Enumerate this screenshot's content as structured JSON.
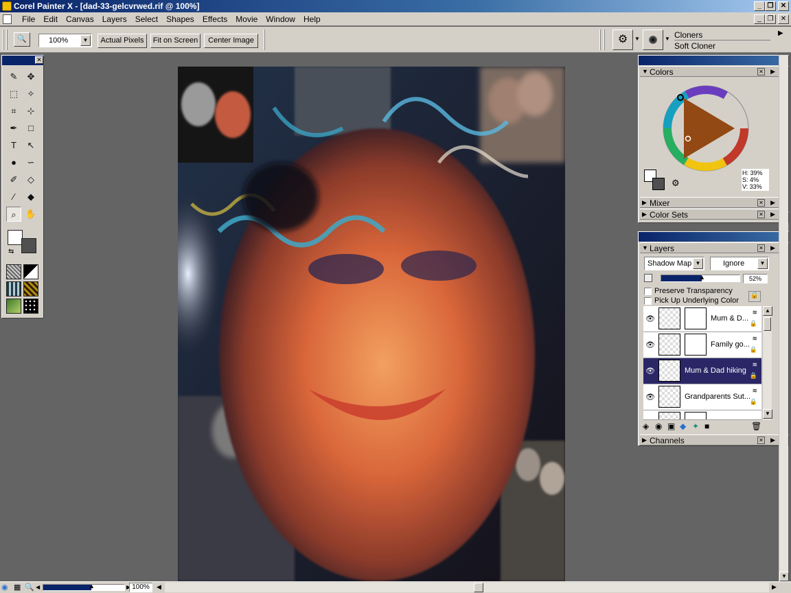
{
  "app": {
    "title": "Corel Painter X - [dad-33-gelcvrwed.rif @ 100%]"
  },
  "window_controls": {
    "minimize": "_",
    "restore": "❐",
    "close": "✕"
  },
  "menu": [
    "File",
    "Edit",
    "Canvas",
    "Layers",
    "Select",
    "Shapes",
    "Effects",
    "Movie",
    "Window",
    "Help"
  ],
  "property_bar": {
    "zoom_value": "100%",
    "actual_pixels": "Actual Pixels",
    "fit_on_screen": "Fit on Screen",
    "center_image": "Center Image"
  },
  "brush": {
    "category": "Cloners",
    "variant": "Soft Cloner"
  },
  "toolbox": {
    "tools": [
      "brush-icon",
      "layer-adjuster-icon",
      "rectangular-selection-icon",
      "magic-wand-icon",
      "crop-icon",
      "transform-icon",
      "pen-icon",
      "rectangle-shape-icon",
      "text-icon",
      "shape-selection-icon",
      "dodge-icon",
      "lasso-icon",
      "cloner-icon",
      "eraser-icon",
      "dropper-icon",
      "paint-bucket-icon",
      "magnifier-icon",
      "grabber-icon"
    ],
    "selected_tool": "magnifier-icon",
    "main_color": "#ffffff",
    "additional_color": "#505050"
  },
  "colors_panel": {
    "title": "Colors",
    "hue_readout": "H: 39%",
    "sat_readout": "S: 4%",
    "val_readout": "V: 33%"
  },
  "mixer_panel": {
    "title": "Mixer"
  },
  "color_sets_panel": {
    "title": "Color Sets"
  },
  "layers_panel": {
    "title": "Layers",
    "composite_method": "Shadow Map",
    "composite_depth": "Ignore",
    "opacity": "52%",
    "opacity_value": 52,
    "preserve_transparency": "Preserve Transparency",
    "pick_up_underlying": "Pick Up Underlying Color",
    "layers": [
      {
        "name": "Mum & D...",
        "selected": false
      },
      {
        "name": "Family go...",
        "selected": false
      },
      {
        "name": "Mum & Dad hiking",
        "selected": true
      },
      {
        "name": "Grandparents Sut...",
        "selected": false
      }
    ]
  },
  "channels_panel": {
    "title": "Channels"
  },
  "status": {
    "zoom": "100%"
  }
}
